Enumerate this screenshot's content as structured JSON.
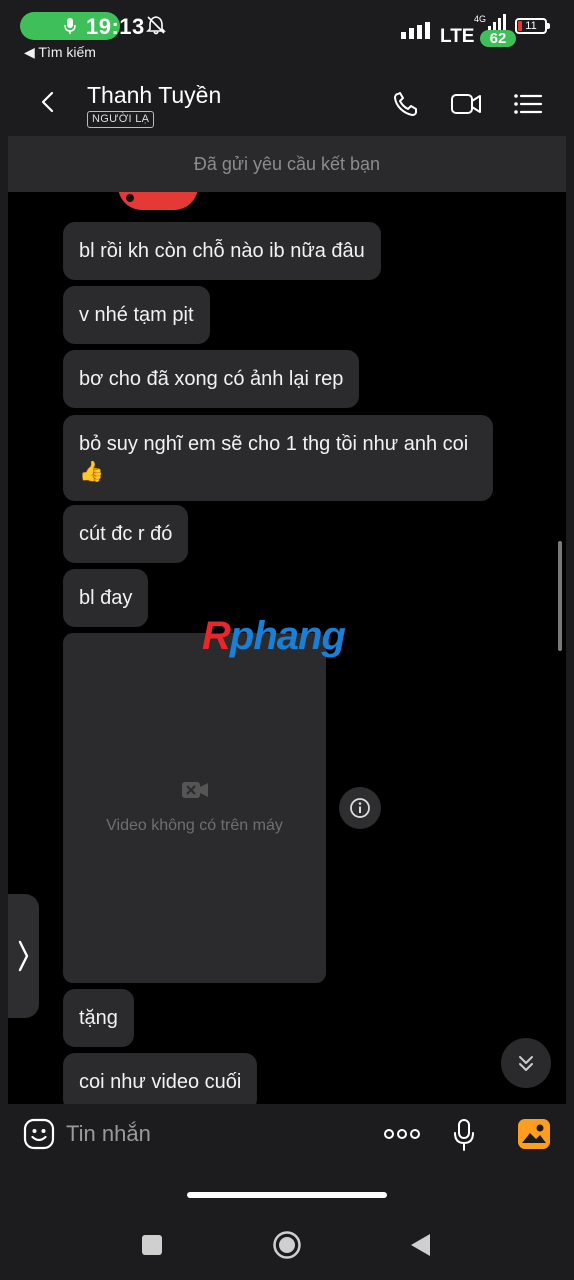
{
  "status_bar": {
    "time": "19:13",
    "back_app_label": "◀ Tìm kiếm",
    "network": "LTE",
    "network_small": "4G",
    "badge": "62",
    "battery": "11"
  },
  "header": {
    "contact_name": "Thanh Tuyền",
    "contact_tag": "NGƯỜI LẠ",
    "banner_text": "Đã gửi yêu cầu kết bạn",
    "icons": [
      "back-icon",
      "phone-icon",
      "video-call-icon",
      "menu-icon"
    ]
  },
  "messages": [
    {
      "text": "bl rồi kh còn chỗ nào ib nữa đâu"
    },
    {
      "text": "v nhé tạm pịt"
    },
    {
      "text": "bơ cho đã xong có ảnh lại rep"
    },
    {
      "text": "bỏ suy nghĩ em sẽ cho 1 thg tồi như anh coi👍"
    },
    {
      "text": "cút đc r đó"
    },
    {
      "text": "bl đay"
    },
    {
      "type": "video",
      "text": "Video không có trên máy"
    },
    {
      "text": "tặng"
    },
    {
      "text": "coi như video cuối"
    }
  ],
  "composer": {
    "placeholder": "Tin nhắn"
  },
  "watermark": {
    "part1": "R",
    "part2": "phang"
  },
  "colors": {
    "bubble": "#2b2b2d",
    "accent_green": "#3fbf5a",
    "image_button": "#ff9d1f",
    "watermark_red": "#e8262b",
    "watermark_blue": "#1a7fd6"
  }
}
